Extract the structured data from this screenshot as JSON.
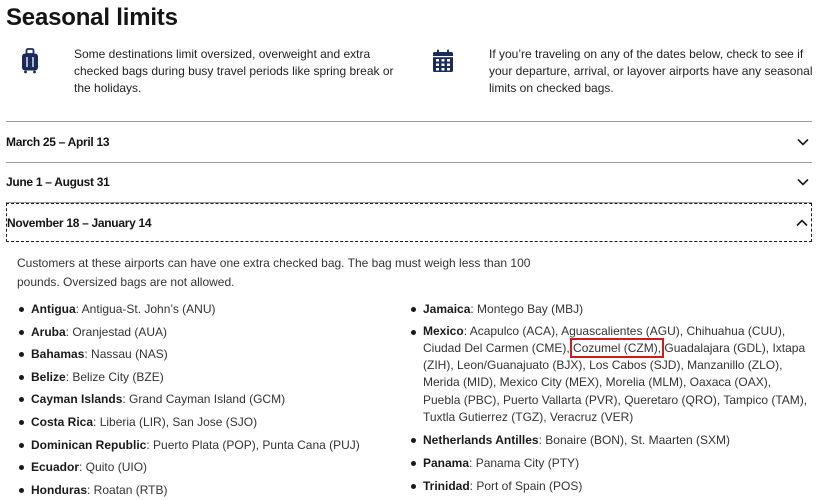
{
  "page_title": "Seasonal limits",
  "intro": {
    "left_text": "Some destinations limit oversized, overweight and extra checked bags during busy travel periods like spring break or the holidays.",
    "right_text": "If you’re traveling on any of the dates below, check to see if your departure, arrival, or layover airports have any seasonal limits on checked bags.",
    "left_icon": "luggage-icon",
    "right_icon": "calendar-icon"
  },
  "accordion": [
    {
      "label": "March 25 – April 13",
      "expanded": false
    },
    {
      "label": "June 1 – August 31",
      "expanded": false
    },
    {
      "label": "November 18 – January 14",
      "expanded": true
    }
  ],
  "panel": {
    "description": "Customers at these airports can have one extra checked bag. The bag must weigh less than 100 pounds. Oversized bags are not allowed.",
    "left_list": [
      {
        "country": "Antigua",
        "airports": ": Antigua-St. John’s (ANU)"
      },
      {
        "country": "Aruba",
        "airports": ": Oranjestad (AUA)"
      },
      {
        "country": "Bahamas",
        "airports": ": Nassau (NAS)"
      },
      {
        "country": "Belize",
        "airports": ": Belize City (BZE)"
      },
      {
        "country": "Cayman Islands",
        "airports": ": Grand Cayman Island (GCM)"
      },
      {
        "country": "Costa Rica",
        "airports": ": Liberia (LIR), San Jose (SJO)"
      },
      {
        "country": "Dominican Republic",
        "airports": ": Puerto Plata (POP), Punta Cana (PUJ)"
      },
      {
        "country": "Ecuador",
        "airports": ": Quito (UIO)"
      },
      {
        "country": "Honduras",
        "airports": ": Roatan (RTB)"
      }
    ],
    "jamaica": {
      "country": "Jamaica",
      "airports": ": Montego Bay (MBJ)"
    },
    "mexico": {
      "country": "Mexico",
      "before": ": Acapulco (ACA), Aguascalientes (AGU), Chihuahua (CUU), Ciudad Del Carmen (CME), ",
      "highlight": "Cozumel (CZM),",
      "after": " Guadalajara (GDL), Ixtapa (ZIH), Leon/Guanajuato (BJX), Los Cabos (SJD), Manzanillo (ZLO), Merida (MID), Mexico City (MEX), Morelia (MLM), Oaxaca (OAX), Puebla (PBC), Puerto Vallarta (PVR), Queretaro (QRO), Tampico (TAM), Tuxtla Gutierrez (TGZ), Veracruz (VER)"
    },
    "right_rest": [
      {
        "country": "Netherlands Antilles",
        "airports": ": Bonaire (BON), St. Maarten (SXM)"
      },
      {
        "country": "Panama",
        "airports": ": Panama City (PTY)"
      },
      {
        "country": "Trinidad",
        "airports": ": Port of Spain (POS)"
      }
    ]
  },
  "colors": {
    "highlight_border": "#d11a1a",
    "text": "#1a1a1a",
    "divider": "#9a9a9a"
  }
}
